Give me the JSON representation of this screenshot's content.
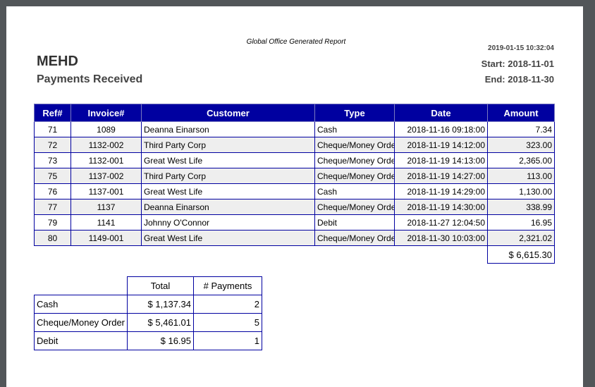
{
  "report": {
    "generated_label": "Global Office Generated Report",
    "organization": "MEHD",
    "subtitle": "Payments Received",
    "timestamp": "2019-01-15 10:32:04",
    "start": "Start: 2018-11-01",
    "end": "End: 2018-11-30"
  },
  "payments": {
    "headers": [
      "Ref#",
      "Invoice#",
      "Customer",
      "Type",
      "Date",
      "Amount"
    ],
    "rows": [
      [
        "71",
        "1089",
        "Deanna Einarson",
        "Cash",
        "2018-11-16 09:18:00",
        "7.34"
      ],
      [
        "72",
        "1132-002",
        "Third Party Corp",
        "Cheque/Money Orde",
        "2018-11-19 14:12:00",
        "323.00"
      ],
      [
        "73",
        "1132-001",
        "Great West Life",
        "Cheque/Money Order",
        "2018-11-19 14:13:00",
        "2,365.00"
      ],
      [
        "75",
        "1137-002",
        "Third Party Corp",
        "Cheque/Money Orde",
        "2018-11-19 14:27:00",
        "113.00"
      ],
      [
        "76",
        "1137-001",
        "Great West Life",
        "Cash",
        "2018-11-19 14:29:00",
        "1,130.00"
      ],
      [
        "77",
        "1137",
        "Deanna Einarson",
        "Cheque/Money Orde",
        "2018-11-19 14:30:00",
        "338.99"
      ],
      [
        "79",
        "1141",
        "Johnny O'Connor",
        "Debit",
        "2018-11-27 12:04:50",
        "16.95"
      ],
      [
        "80",
        "1149-001",
        "Great West Life",
        "Cheque/Money Orde",
        "2018-11-30 10:03:00",
        "2,321.02"
      ]
    ],
    "grand_total": "$ 6,615.30"
  },
  "summary": {
    "headers": [
      "",
      "Total",
      "# Payments"
    ],
    "rows": [
      [
        "Cash",
        "$ 1,137.34",
        "2"
      ],
      [
        "Cheque/Money Order",
        "$ 5,461.01",
        "5"
      ],
      [
        "Debit",
        "$ 16.95",
        "1"
      ]
    ]
  },
  "colors": {
    "header_bg": "#0000a0",
    "border": "#0000a0",
    "alt_row": "#eeeeee",
    "viewer_bg": "#525659"
  }
}
